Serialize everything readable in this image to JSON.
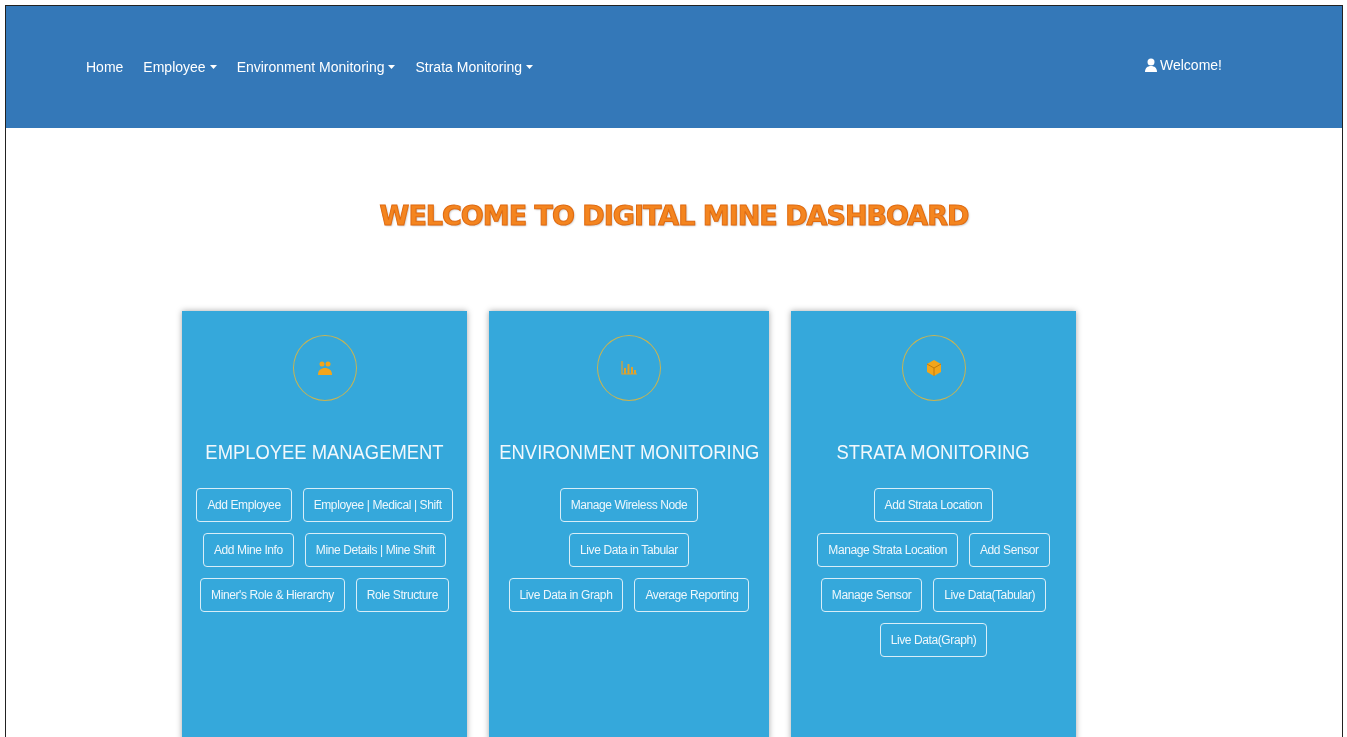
{
  "navbar": {
    "items": [
      {
        "label": "Home",
        "dropdown": false
      },
      {
        "label": "Employee",
        "dropdown": true
      },
      {
        "label": "Environment Monitoring",
        "dropdown": true
      },
      {
        "label": "Strata Monitoring",
        "dropdown": true
      }
    ],
    "user": {
      "label": "Welcome!"
    }
  },
  "heading": "WELCOME TO DIGITAL MINE DASHBOARD",
  "cards": [
    {
      "kind": "employee",
      "title": "EMPLOYEE MANAGEMENT",
      "button_rows": [
        [
          "Add Employee",
          "Employee | Medical | Shift"
        ],
        [
          "Add Mine Info",
          "Mine Details | Mine Shift"
        ],
        [
          "Miner's Role & Hierarchy",
          "Role Structure"
        ]
      ]
    },
    {
      "kind": "chart",
      "title": "ENVIRONMENT MONITORING",
      "button_rows": [
        [
          "Manage Wireless Node"
        ],
        [
          "Live Data in Tabular"
        ],
        [
          "Live Data in Graph",
          "Average Reporting"
        ]
      ]
    },
    {
      "kind": "cube",
      "title": "STRATA MONITORING",
      "button_rows": [
        [
          "Add Strata Location"
        ],
        [
          "Manage Strata Location",
          "Add Sensor"
        ],
        [
          "Manage Sensor",
          "Live Data(Tabular)"
        ],
        [
          "Live Data(Graph)"
        ]
      ]
    }
  ]
}
